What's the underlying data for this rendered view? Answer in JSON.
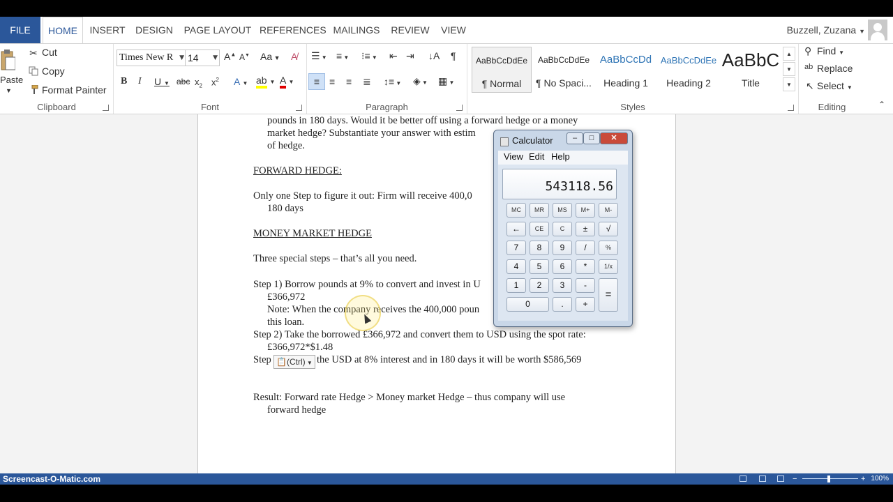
{
  "ribbon": {
    "tabs": [
      "FILE",
      "HOME",
      "INSERT",
      "DESIGN",
      "PAGE LAYOUT",
      "REFERENCES",
      "MAILINGS",
      "REVIEW",
      "VIEW"
    ],
    "user": "Buzzell, Zuzana",
    "clipboard": {
      "paste": "Paste",
      "cut": "Cut",
      "copy": "Copy",
      "format_painter": "Format Painter",
      "label": "Clipboard"
    },
    "font": {
      "name": "Times New R",
      "size": "14",
      "label": "Font"
    },
    "paragraph": {
      "label": "Paragraph"
    },
    "styles": {
      "items": [
        {
          "sample": "AaBbCcDdEe",
          "name": "¶ Normal"
        },
        {
          "sample": "AaBbCcDdEe",
          "name": "¶ No Spaci..."
        },
        {
          "sample": "AaBbCcDd",
          "name": "Heading 1"
        },
        {
          "sample": "AaBbCcDdEe",
          "name": "Heading 2"
        },
        {
          "sample": "AaBbC",
          "name": "Title"
        }
      ],
      "label": "Styles"
    },
    "editing": {
      "find": "Find",
      "replace": "Replace",
      "select": "Select",
      "label": "Editing"
    }
  },
  "document": {
    "lines": [
      "pounds in 180 days.  Would it be better off using a forward hedge or a money",
      "market hedge?  Substantiate your answer with estim",
      "of hedge.",
      "FORWARD HEDGE:",
      "Only one Step to figure it out:  Firm will receive 400,0",
      "180 days",
      "MONEY MARKET HEDGE",
      "Three special steps – that’s all you need.",
      "Step 1) Borrow pounds at 9% to convert and invest in U",
      "£366,972",
      "Note: When the company receives the 400,000 poun",
      "this loan.",
      "Step 2) Take the borrowed £366,972 and convert them to USD using the spot rate:",
      "£366,972*$1.48",
      "Step",
      "the USD at 8% interest and in 180 days it will be worth $586,569",
      "Result: Forward rate Hedge > Money market Hedge – thus company will use",
      "forward hedge"
    ],
    "paste_options": "(Ctrl)"
  },
  "calculator": {
    "title": "Calculator",
    "menu": [
      "View",
      "Edit",
      "Help"
    ],
    "display": "543118.56",
    "keys": {
      "mem": [
        "MC",
        "MR",
        "MS",
        "M+",
        "M-"
      ],
      "row2": [
        "←",
        "CE",
        "C",
        "±",
        "√"
      ],
      "row3": [
        "7",
        "8",
        "9",
        "/",
        "%"
      ],
      "row4": [
        "4",
        "5",
        "6",
        "*",
        "1/x"
      ],
      "row5": [
        "1",
        "2",
        "3",
        "-",
        "="
      ],
      "row6": [
        "0",
        ".",
        "+"
      ]
    }
  },
  "statusbar": {
    "watermark": "Screencast-O-Matic.com",
    "zoom": "100%"
  }
}
